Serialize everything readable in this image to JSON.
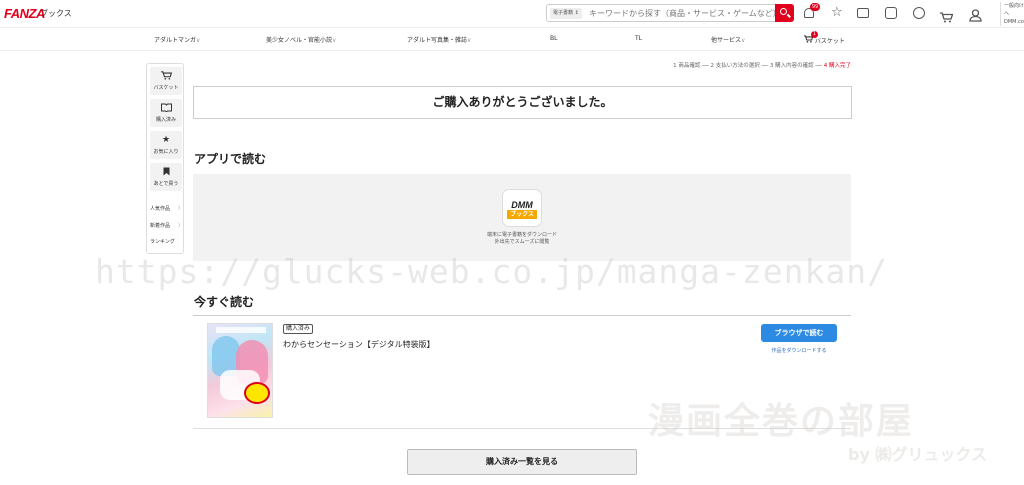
{
  "header": {
    "logo": "FANZA",
    "logo_sub": "ブックス",
    "search_category": "電子書籍 ↕",
    "search_placeholder": "キーワードから探す（商品・サービス・ゲームなど）",
    "notification_count": "99",
    "account_lines": [
      "一般向けへ",
      "DMM.com"
    ]
  },
  "nav": {
    "items": [
      {
        "label": "アダルトマンガ",
        "chevron": "∨"
      },
      {
        "label": "美少女ノベル・官能小説",
        "chevron": "∨"
      },
      {
        "label": "アダルト写真集・雑誌",
        "chevron": "∨"
      },
      {
        "label": "BL",
        "chevron": ""
      },
      {
        "label": "TL",
        "chevron": ""
      },
      {
        "label": "他サービス",
        "chevron": "∨"
      }
    ],
    "cart_label": "バスケット",
    "cart_count": "1"
  },
  "sidebar": {
    "buttons": [
      {
        "label": "バスケット",
        "icon": "cart-icon"
      },
      {
        "label": "購入済み",
        "icon": "book-icon"
      },
      {
        "label": "お気に入り",
        "icon": "star-icon"
      },
      {
        "label": "あとで買う",
        "icon": "bookmark-icon"
      }
    ],
    "links": [
      {
        "label": "人気作品",
        "chevron": "〉"
      },
      {
        "label": "新着作品",
        "chevron": "〉"
      },
      {
        "label": "ランキング",
        "chevron": ""
      }
    ]
  },
  "steps": {
    "items": [
      "1 商品確認",
      "2 支払い方法の選択",
      "3 購入内容の確認"
    ],
    "active": "4 購入完了",
    "separator": " ── "
  },
  "main": {
    "thanks": "ご購入ありがとうございました。",
    "app_section_title": "アプリで読む",
    "app_logo_top": "DMM",
    "app_logo_bottom": "ブックス",
    "app_caption_1": "端末に電子書籍をダウンロード",
    "app_caption_2": "外出先でスムーズに閲覧",
    "read_now_title": "今すぐ読む",
    "item": {
      "badge": "購入済み",
      "title": "わからセンセーション【デジタル特装版】",
      "read_button": "ブラウザで読む",
      "download_link": "作品をダウンロードする"
    },
    "purchased_list_button": "購入済み一覧を見る"
  },
  "watermarks": {
    "url": "https://glucks-web.co.jp/manga-zenkan/",
    "logo": "漫画全巻の部屋",
    "by": "by ㈱グリュックス"
  },
  "colors": {
    "brand": "#e0001b",
    "button_blue": "#2d8ae2",
    "link_blue": "#2d6cc0",
    "app_logo_orange": "#f6a800"
  }
}
